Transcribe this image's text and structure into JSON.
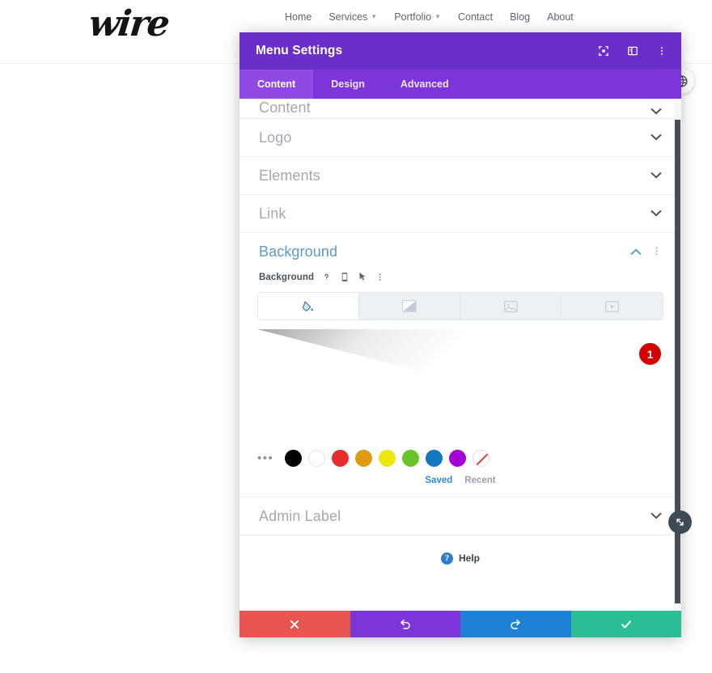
{
  "site": {
    "logo_text": "wire",
    "nav": [
      {
        "label": "Home",
        "has_caret": false
      },
      {
        "label": "Services",
        "has_caret": true
      },
      {
        "label": "Portfolio",
        "has_caret": true
      },
      {
        "label": "Contact",
        "has_caret": false
      },
      {
        "label": "Blog",
        "has_caret": false
      },
      {
        "label": "About",
        "has_caret": false
      }
    ]
  },
  "modal": {
    "title": "Menu Settings",
    "titlebar_icons": [
      "fullscreen-icon",
      "panel-layout-icon",
      "more-vertical-icon"
    ],
    "tabs": [
      {
        "label": "Content",
        "active": true
      },
      {
        "label": "Design",
        "active": false
      },
      {
        "label": "Advanced",
        "active": false
      }
    ],
    "sections": [
      {
        "label": "Content",
        "state": "collapsed"
      },
      {
        "label": "Logo",
        "state": "collapsed"
      },
      {
        "label": "Elements",
        "state": "collapsed"
      },
      {
        "label": "Link",
        "state": "collapsed"
      },
      {
        "label": "Background",
        "state": "expanded"
      },
      {
        "label": "Admin Label",
        "state": "collapsed"
      }
    ],
    "background": {
      "section_title": "Background",
      "field_label": "Background",
      "field_icons": [
        "help-icon",
        "responsive-mobile-icon",
        "hover-cursor-icon",
        "more-vertical-icon"
      ],
      "type_tabs": [
        {
          "name": "background-color-tab",
          "icon": "paint-bucket-icon",
          "active": true
        },
        {
          "name": "background-gradient-tab",
          "icon": "gradient-icon",
          "active": false
        },
        {
          "name": "background-image-tab",
          "icon": "image-icon",
          "active": false
        },
        {
          "name": "background-video-tab",
          "icon": "video-icon",
          "active": false
        }
      ],
      "preview_tools": [
        "gear-icon",
        "trash-icon"
      ],
      "badge_count": "1",
      "swatches": [
        {
          "name": "black",
          "color": "#000000"
        },
        {
          "name": "white",
          "color": "#ffffff"
        },
        {
          "name": "red",
          "color": "#e82c2c"
        },
        {
          "name": "orange",
          "color": "#e09a10"
        },
        {
          "name": "yellow",
          "color": "#ede70f"
        },
        {
          "name": "green",
          "color": "#67c52b"
        },
        {
          "name": "blue",
          "color": "#1278bf"
        },
        {
          "name": "purple",
          "color": "#a200d6"
        },
        {
          "name": "transparent",
          "color": "transparent"
        }
      ],
      "more_swatches_label": "•••",
      "palette_tabs": [
        {
          "label": "Saved",
          "active": true
        },
        {
          "label": "Recent",
          "active": false
        }
      ]
    },
    "help": {
      "label": "Help",
      "icon_char": "?"
    },
    "footer_buttons": [
      {
        "name": "cancel-button",
        "icon": "close-icon",
        "color": "#e8544f"
      },
      {
        "name": "undo-button",
        "icon": "undo-icon",
        "color": "#7b35d8"
      },
      {
        "name": "redo-button",
        "icon": "redo-icon",
        "color": "#1d82d6"
      },
      {
        "name": "save-button",
        "icon": "check-icon",
        "color": "#2bbd94"
      }
    ]
  },
  "colors": {
    "titlebar_purple": "#6b2fc9",
    "tabbar_purple": "#7b35d8",
    "active_tab_purple": "#8f4ae6",
    "accent_blue": "#5b9bc4",
    "badge_red": "#d40000",
    "scrollbar_dark": "#434f5b"
  }
}
